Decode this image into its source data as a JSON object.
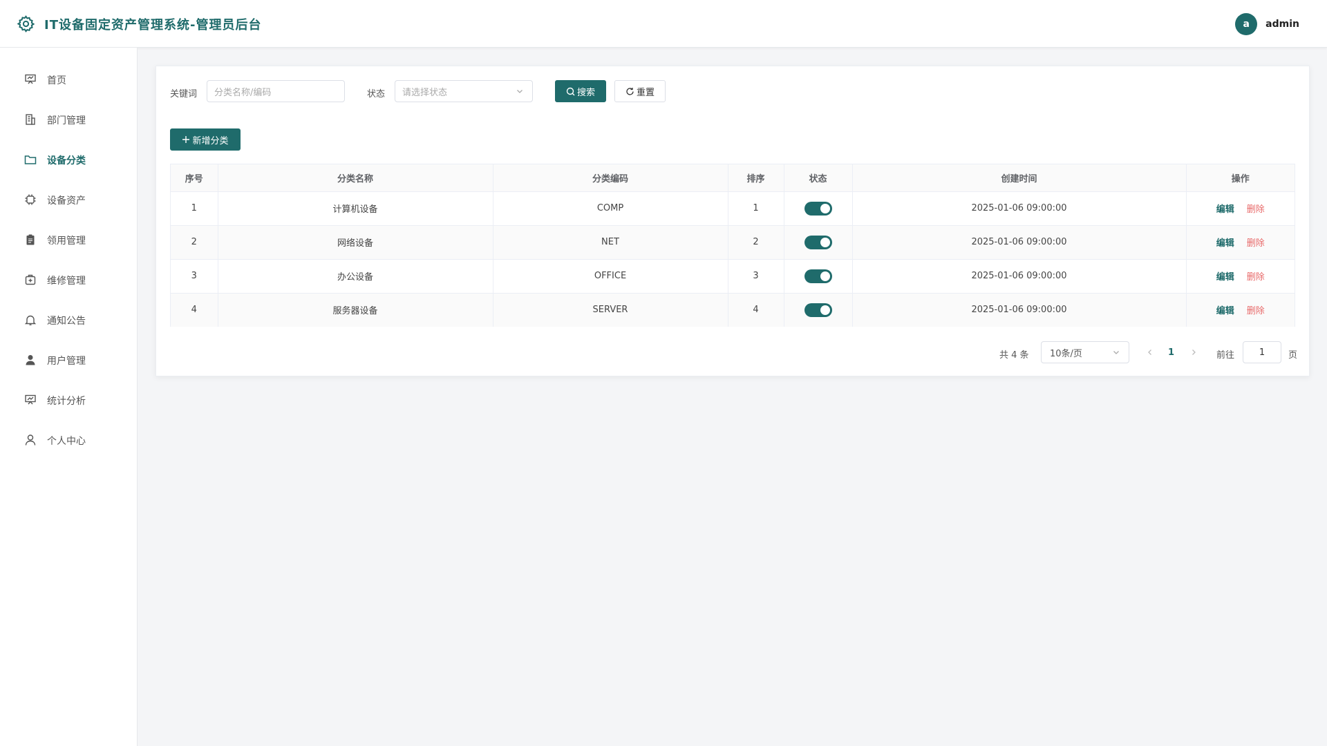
{
  "header": {
    "title": "IT设备固定资产管理系统-管理员后台",
    "avatar_letter": "a",
    "username": "admin",
    "accent": "#1f6b6b"
  },
  "sidebar": {
    "items": [
      {
        "label": "首页",
        "icon": "home-icon",
        "active": false
      },
      {
        "label": "部门管理",
        "icon": "building-icon",
        "active": false
      },
      {
        "label": "设备分类",
        "icon": "folder-icon",
        "active": true
      },
      {
        "label": "设备资产",
        "icon": "chip-icon",
        "active": false
      },
      {
        "label": "领用管理",
        "icon": "clipboard-icon",
        "active": false
      },
      {
        "label": "维修管理",
        "icon": "medkit-icon",
        "active": false
      },
      {
        "label": "通知公告",
        "icon": "bell-icon",
        "active": false
      },
      {
        "label": "用户管理",
        "icon": "user-filled-icon",
        "active": false
      },
      {
        "label": "统计分析",
        "icon": "chart-board-icon",
        "active": false
      },
      {
        "label": "个人中心",
        "icon": "user-outline-icon",
        "active": false
      }
    ]
  },
  "filters": {
    "keyword_label": "关键词",
    "keyword_placeholder": "分类名称/编码",
    "status_label": "状态",
    "status_placeholder": "请选择状态",
    "search_label": "搜索",
    "reset_label": "重置"
  },
  "actions": {
    "add_label": "新增分类"
  },
  "table": {
    "columns": [
      "序号",
      "分类名称",
      "分类编码",
      "排序",
      "状态",
      "创建时间",
      "操作"
    ],
    "rows": [
      {
        "index": "1",
        "name": "计算机设备",
        "code": "COMP",
        "sort": "1",
        "enabled": true,
        "created": "2025-01-06 09:00:00"
      },
      {
        "index": "2",
        "name": "网络设备",
        "code": "NET",
        "sort": "2",
        "enabled": true,
        "created": "2025-01-06 09:00:00"
      },
      {
        "index": "3",
        "name": "办公设备",
        "code": "OFFICE",
        "sort": "3",
        "enabled": true,
        "created": "2025-01-06 09:00:00"
      },
      {
        "index": "4",
        "name": "服务器设备",
        "code": "SERVER",
        "sort": "4",
        "enabled": true,
        "created": "2025-01-06 09:00:00"
      }
    ],
    "edit_label": "编辑",
    "delete_label": "删除"
  },
  "pagination": {
    "total_text": "共 4 条",
    "page_size": "10条/页",
    "current_page": "1",
    "goto_label": "前往",
    "goto_value": "1",
    "page_suffix": "页"
  }
}
